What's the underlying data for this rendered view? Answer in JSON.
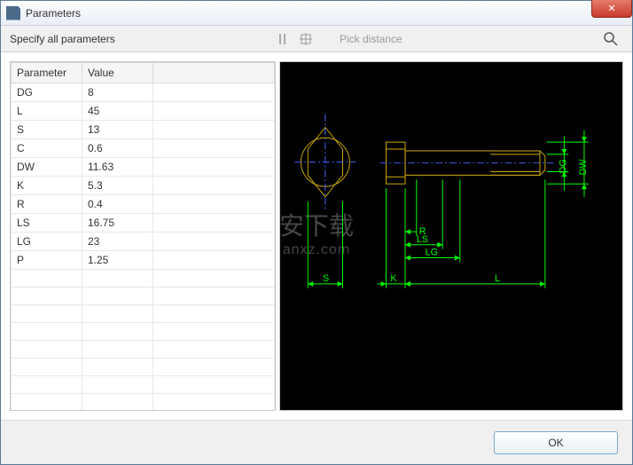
{
  "window": {
    "title": "Parameters",
    "close_label": "✕"
  },
  "toolbar": {
    "instruction": "Specify all parameters",
    "pick_distance": "Pick distance"
  },
  "table": {
    "headers": {
      "param": "Parameter",
      "value": "Value"
    },
    "rows": [
      {
        "param": "DG",
        "value": "8"
      },
      {
        "param": "L",
        "value": "45"
      },
      {
        "param": "S",
        "value": "13"
      },
      {
        "param": "C",
        "value": "0.6"
      },
      {
        "param": "DW",
        "value": "11.63"
      },
      {
        "param": "K",
        "value": "5.3"
      },
      {
        "param": "R",
        "value": "0.4"
      },
      {
        "param": "LS",
        "value": "16.75"
      },
      {
        "param": "LG",
        "value": "23"
      },
      {
        "param": "P",
        "value": "1.25"
      }
    ]
  },
  "drawing_labels": {
    "S": "S",
    "K": "K",
    "R": "R",
    "LS": "LS",
    "LG": "LG",
    "L": "L",
    "DG": "DG",
    "DW": "DW"
  },
  "buttons": {
    "ok": "OK"
  },
  "watermark": {
    "line1": "安下载",
    "line2": "anxz.com"
  }
}
